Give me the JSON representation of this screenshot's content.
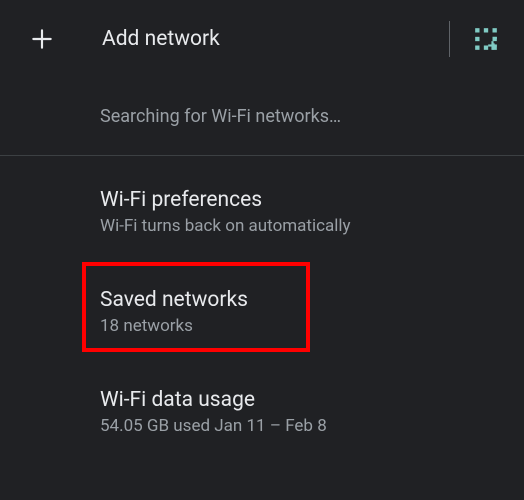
{
  "header": {
    "add_label": "Add network"
  },
  "status": {
    "text": "Searching for Wi-Fi networks…"
  },
  "items": [
    {
      "title": "Wi-Fi preferences",
      "subtitle": "Wi-Fi turns back on automatically"
    },
    {
      "title": "Saved networks",
      "subtitle": "18 networks"
    },
    {
      "title": "Wi-Fi data usage",
      "subtitle": "54.05 GB used Jan 11 – Feb 8"
    }
  ]
}
